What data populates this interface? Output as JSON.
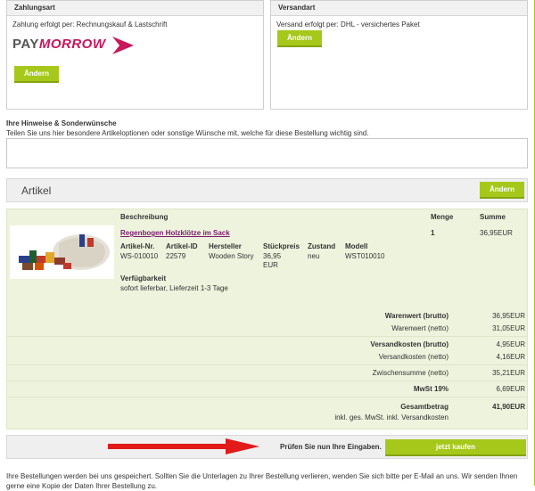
{
  "payment": {
    "title": "Zahlungsart",
    "text": "Zahlung erfolgt per: Rechnungskauf & Lastschrift",
    "logo_text": "PAYMORROW",
    "button": "Ändern"
  },
  "shipping": {
    "title": "Versandart",
    "text": "Versand erfolgt per: DHL - versichertes Paket",
    "button": "Ändern"
  },
  "notes": {
    "title": "Ihre Hinweise & Sonderwünsche",
    "description": "Teilen Sie uns hier besondere Artikeloptionen oder sonstige Wünsche mit, welche für diese Bestellung wichtig sind.",
    "value": ""
  },
  "articles": {
    "title": "Artikel",
    "button": "Ändern",
    "headers": {
      "description": "Beschreibung",
      "quantity": "Menge",
      "sum": "Summe"
    },
    "item": {
      "name": "Regenbogen Holzklötze im Sack",
      "col_labels": {
        "art_nr": "Artikel-Nr.",
        "art_id": "Artikel-ID",
        "maker": "Hersteller",
        "price": "Stückpreis",
        "state": "Zustand",
        "model": "Modell"
      },
      "art_nr": "WS-010010",
      "art_id": "22579",
      "maker": "Wooden Story",
      "price_line1": "36,95",
      "price_line2": "EUR",
      "state": "neu",
      "model": "WST010010",
      "availability_label": "Verfügbarkeit",
      "availability": "sofort lieferbar, Lieferzeit 1-3 Tage",
      "quantity": "1",
      "sum": "36,95EUR"
    }
  },
  "totals": [
    {
      "label": "Warenwert (brutto)",
      "value": "36,95EUR",
      "bold": true
    },
    {
      "label": "Warenwert (netto)",
      "value": "31,05EUR",
      "bold": false
    },
    {
      "label": "Versandkosten (brutto)",
      "value": "4,95EUR",
      "bold": true
    },
    {
      "label": "Versandkosten (netto)",
      "value": "4,16EUR",
      "bold": false
    },
    {
      "label": "Zwischensumme (netto)",
      "value": "35,21EUR",
      "bold": false
    },
    {
      "label": "MwSt 19%",
      "value": "6,69EUR",
      "bold": true
    },
    {
      "label": "Gesamtbetrag",
      "value": "41,90EUR",
      "bold": true
    }
  ],
  "totals_note": "inkl. ges. MwSt. inkl. Versandkosten",
  "check": {
    "text": "Prüfen Sie nun Ihre Eingaben.",
    "button": "jetzt kaufen"
  },
  "footer": "Ihre Bestellungen werden bei uns gespeichert. Sollten Sie die Unterlagen zu Ihrer Bestellung verlieren, wenden Sie sich bitte per E-Mail an uns. Wir senden Ihnen gerne eine Kopie der Daten Ihrer Bestellung zu.",
  "colors": {
    "accent": "#a5c81b",
    "panel_bg": "#eef3dd",
    "arrow": "#e21a1a",
    "logo_pink": "#c8175d"
  }
}
